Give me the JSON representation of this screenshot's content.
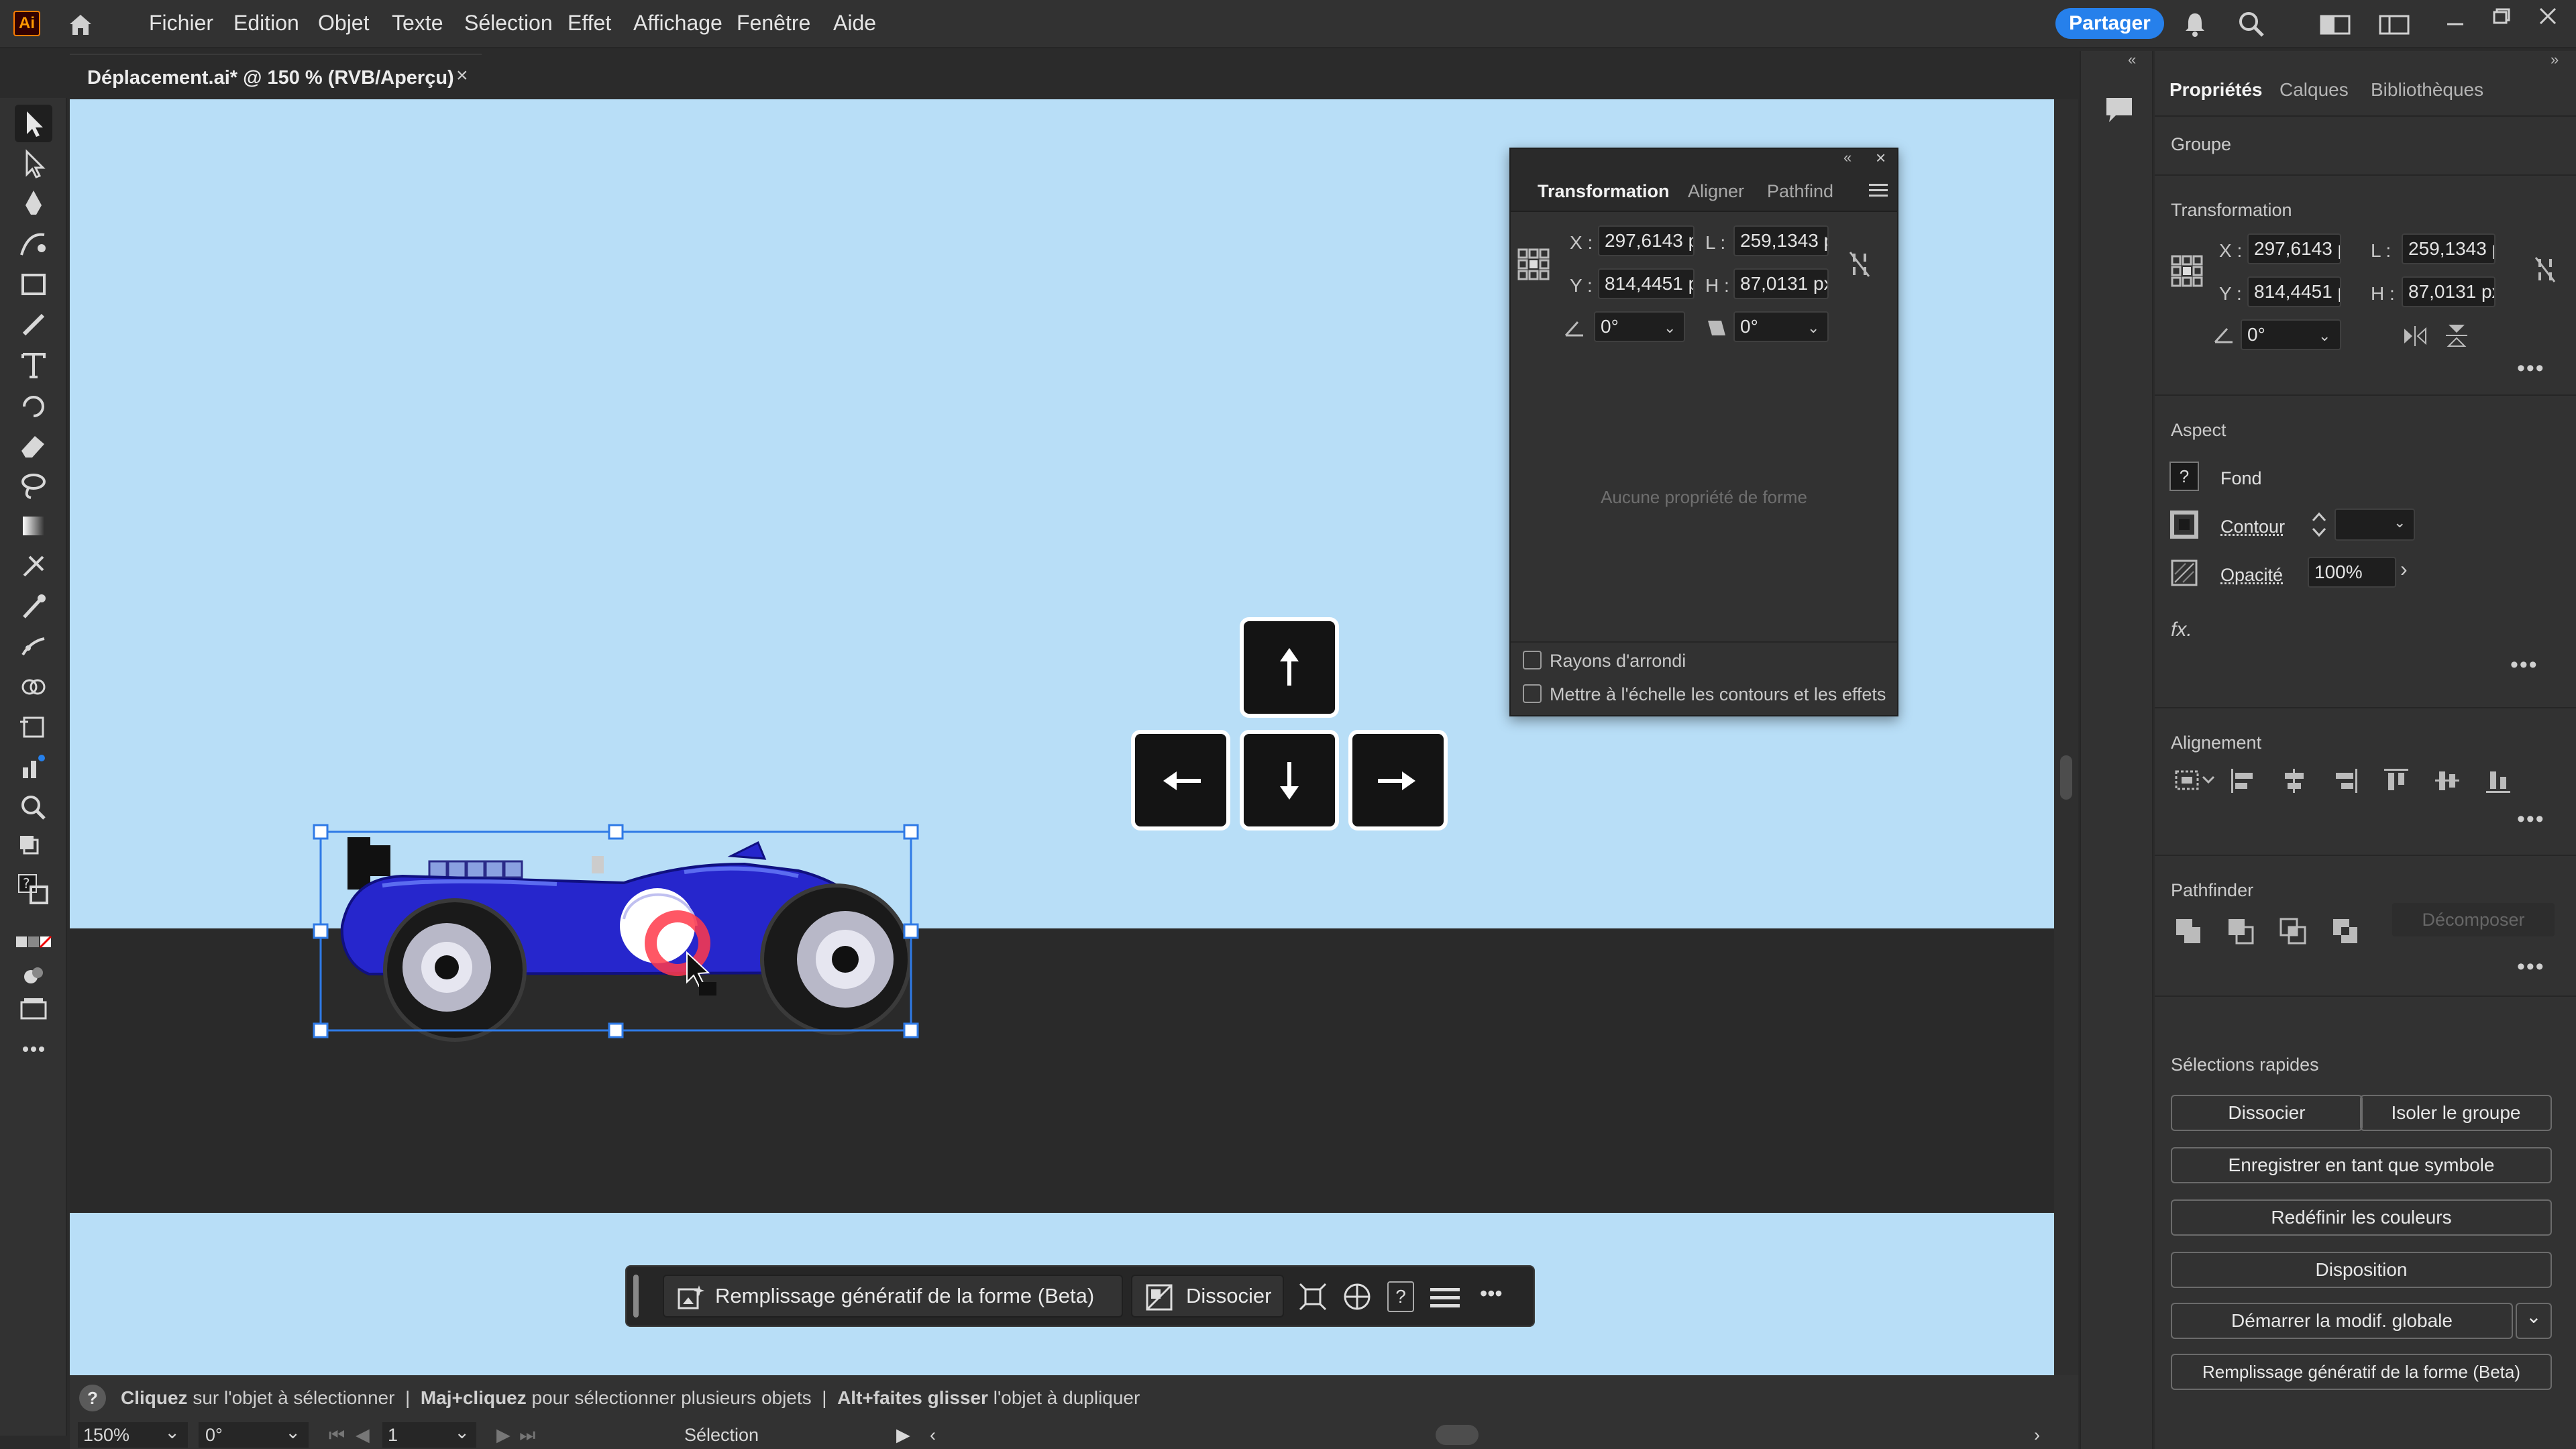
{
  "app": {
    "logo": "Ai"
  },
  "menu": [
    "Fichier",
    "Edition",
    "Objet",
    "Texte",
    "Sélection",
    "Effet",
    "Affichage",
    "Fenêtre",
    "Aide"
  ],
  "share_label": "Partager",
  "document_tab": {
    "title": "Déplacement.ai* @ 150 % (RVB/Aperçu)",
    "close": "×"
  },
  "transform_panel": {
    "tabs": [
      "Transformation",
      "Aligner",
      "Pathfinder"
    ],
    "x_label": "X :",
    "x": "297,6143 p",
    "w_label": "L :",
    "w": "259,1343 p",
    "y_label": "Y :",
    "y": "814,4451 p",
    "h_label": "H :",
    "h": "87,0131 px",
    "angle": "0°",
    "shear": "0°",
    "empty_text": "Aucune propriété de forme",
    "check_round": "Rayons d'arrondi",
    "check_scale": "Mettre à l'échelle les contours et les effets"
  },
  "context_bar": {
    "gen_fill": "Remplissage génératif de la forme (Beta)",
    "ungroup": "Dissocier",
    "help": "?",
    "more": "•••"
  },
  "status": {
    "help": "?",
    "hint_parts": [
      {
        "b": "Cliquez",
        "t": " sur l'objet à sélectionner  |  "
      },
      {
        "b": "Maj+cliquez",
        "t": " pour sélectionner plusieurs objets  |  "
      },
      {
        "b": "Alt+faites glisser",
        "t": " l'objet à dupliquer"
      }
    ],
    "zoom": "150%",
    "rotation": "0°",
    "artboard": "1",
    "tool": "Sélection"
  },
  "properties": {
    "tabs": [
      "Propriétés",
      "Calques",
      "Bibliothèques"
    ],
    "object_type": "Groupe",
    "transform_title": "Transformation",
    "x_label": "X :",
    "x": "297,6143 p",
    "w_label": "L :",
    "w": "259,1343 p",
    "y_label": "Y :",
    "y": "814,4451 p",
    "h_label": "H :",
    "h": "87,0131 px",
    "angle": "0°",
    "aspect_title": "Aspect",
    "fill_label": "Fond",
    "fill_icon": "?",
    "stroke_label": "Contour",
    "opacity_label": "Opacité",
    "opacity": "100%",
    "fx": "fx.",
    "align_title": "Alignement",
    "pathfinder_title": "Pathfinder",
    "decompose": "Décomposer",
    "quick_title": "Sélections rapides",
    "buttons": {
      "ungroup": "Dissocier",
      "isolate": "Isoler le groupe",
      "symbol": "Enregistrer en tant que symbole",
      "recolor": "Redéfinir les couleurs",
      "arrange": "Disposition",
      "global": "Démarrer la modif. globale",
      "genfill": "Remplissage génératif de la forme (Beta)"
    },
    "more": "•••"
  },
  "colors": {
    "accent": "#2680eb",
    "canvas": "#b8def7",
    "car_body": "#2222cc"
  }
}
